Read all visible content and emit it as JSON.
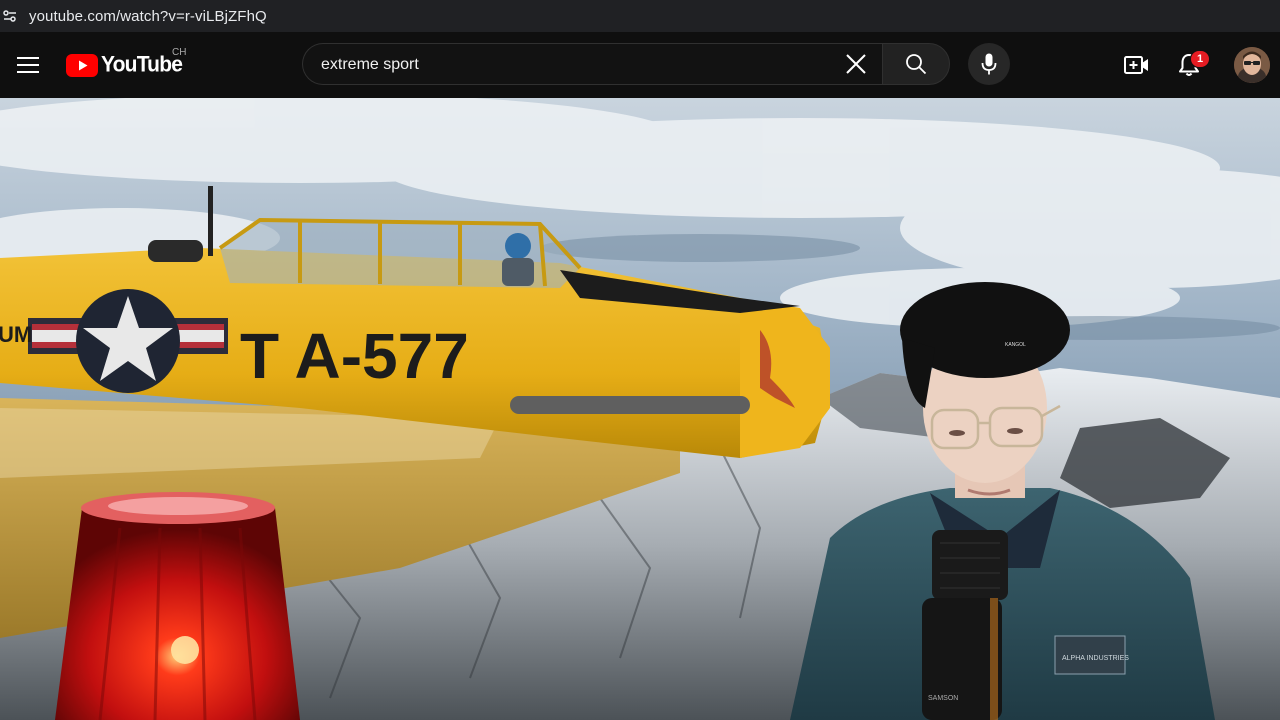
{
  "browser": {
    "url": "youtube.com/watch?v=r-viLBjZFhQ"
  },
  "header": {
    "logo_text": "YouTube",
    "country_code": "CH",
    "search_value": "extreme sport",
    "notification_count": "1",
    "icons": {
      "menu": "hamburger-menu-icon",
      "clear": "close-icon",
      "search": "search-icon",
      "mic": "microphone-icon",
      "create": "video-add-icon",
      "notifications": "bell-icon"
    },
    "colors": {
      "brand_red": "#ff0000",
      "badge_red": "#e51c23",
      "background": "#0f0f0f"
    }
  },
  "video": {
    "plane_marking": "T A-577",
    "plane_side_text": "UM",
    "cap_logo": "KANGOL",
    "jacket_patch": "ALPHA INDUSTRIES",
    "mic_brand": "SAMSON"
  }
}
